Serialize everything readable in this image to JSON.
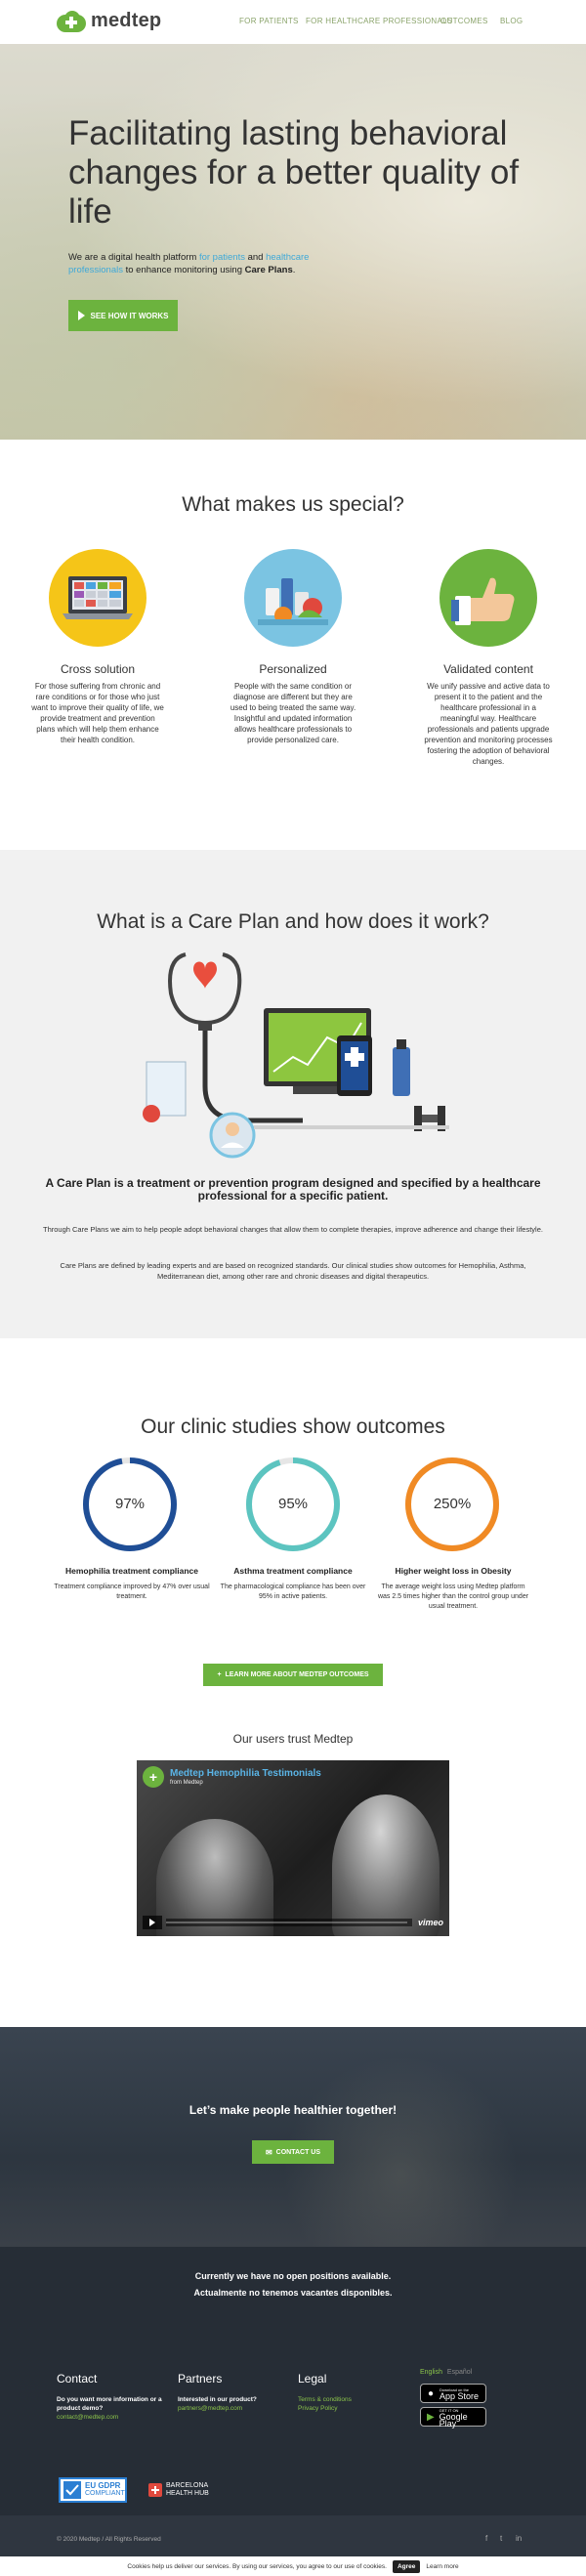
{
  "header": {
    "logo_text": "medtep",
    "nav": [
      "FOR PATIENTS",
      "FOR HEALTHCARE PROFESSIONALS",
      "OUTCOMES",
      "BLOG"
    ]
  },
  "hero": {
    "title": "Facilitating lasting behavioral changes for a better quality of life",
    "sub_1": "We are a digital health platform ",
    "sub_link_1": "for patients",
    "sub_2": " and ",
    "sub_link_2": "healthcare professionals",
    "sub_3": " to enhance monitoring using ",
    "sub_bold": "Care Plans",
    "sub_4": ".",
    "button": "SEE HOW IT WORKS"
  },
  "special": {
    "title": "What makes us special?",
    "features": [
      {
        "title": "Cross solution",
        "text": "For those suffering from chronic and rare conditions or for those who just want to improve their quality of life, we provide treatment and prevention plans which will help them enhance their health condition.",
        "icon": "laptop-dashboard-icon",
        "color": "#f5c518"
      },
      {
        "title": "Personalized",
        "text": "People with the same condition or diagnose are different but they are used to being treated the same way. Insightful and updated information allows healthcare professionals to provide personalized care.",
        "icon": "healthy-food-icon",
        "color": "#7bc4e2"
      },
      {
        "title": "Validated content",
        "text": "We unify passive and active data to present it to the patient and the healthcare professional in a meaningful way. Healthcare professionals and patients upgrade prevention and monitoring processes fostering the adoption of behavioral changes.",
        "icon": "thumbs-up-icon",
        "color": "#6cb33e"
      }
    ]
  },
  "care": {
    "title": "What is a Care Plan and how does it work?",
    "heading": "A Care Plan is a treatment or prevention program designed and specified by a healthcare professional for a specific patient.",
    "p1": "Through Care Plans we aim to help people adopt behavioral changes that allow them to complete therapies, improve adherence and change their lifestyle.",
    "p2": "Care Plans are defined by leading experts and are based on recognized standards. Our clinical studies show outcomes for Hemophilia, Asthma, Mediterranean diet, among other rare and chronic diseases and digital therapeutics."
  },
  "outcomes": {
    "title": "Our clinic studies show outcomes",
    "stats": [
      {
        "value": "97%",
        "title": "Hemophilia treatment compliance",
        "text": "Treatment compliance improved by 47% over usual treatment.",
        "color": "#1f4e96",
        "fill": 0.97
      },
      {
        "value": "95%",
        "title": "Asthma treatment compliance",
        "text": "The pharmacological compliance has been over 95% in active patients.",
        "color": "#5cc4c0",
        "fill": 0.95
      },
      {
        "value": "250%",
        "title": "Higher weight loss in Obesity",
        "text": "The average weight loss using Medtep platform was 2.5 times higher than the control group under usual treatment.",
        "color": "#f08a24",
        "fill": 1.0
      }
    ],
    "button": "LEARN MORE ABOUT MEDTEP OUTCOMES",
    "trust": "Our users trust Medtep",
    "video_title": "Medtep Hemophilia Testimonials",
    "video_from": "from Medtep",
    "video_logo": "vimeo"
  },
  "cta": {
    "title": "Let’s make people healthier together!",
    "button": "CONTACT US"
  },
  "jobs": {
    "en": "Currently we have no open positions available.",
    "es": "Actualmente no tenemos vacantes disponibles."
  },
  "footer": {
    "contact": {
      "title": "Contact",
      "text": "Do you want more information or a product demo?",
      "link": "contact@medtep.com"
    },
    "partners": {
      "title": "Partners",
      "text": "Interested in our product?",
      "link": "partners@medtep.com"
    },
    "legal": {
      "title": "Legal",
      "links": [
        "Terms & conditions",
        "Privacy Policy"
      ]
    },
    "langs": {
      "en": "English",
      "es": "Español"
    },
    "appstore": {
      "small": "Download on the",
      "big": "App Store"
    },
    "googleplay": {
      "small": "GET IT ON",
      "big": "Google Play"
    },
    "gdpr": {
      "line1": "EU GDPR",
      "line2": "COMPLIANT"
    },
    "bhub": {
      "line1": "BARCELONA",
      "line2": "HEALTH HUB"
    },
    "copyright": "© 2020 Medtep / All Rights Reserved"
  },
  "cookie": {
    "text": "Cookies help us deliver our services. By using our services, you agree to our use of cookies.",
    "agree": "Agree",
    "learn": "Learn more"
  },
  "colors": {
    "brand": "#6cb33e",
    "link_blue": "#3fa9d8",
    "dark": "#262d36"
  }
}
